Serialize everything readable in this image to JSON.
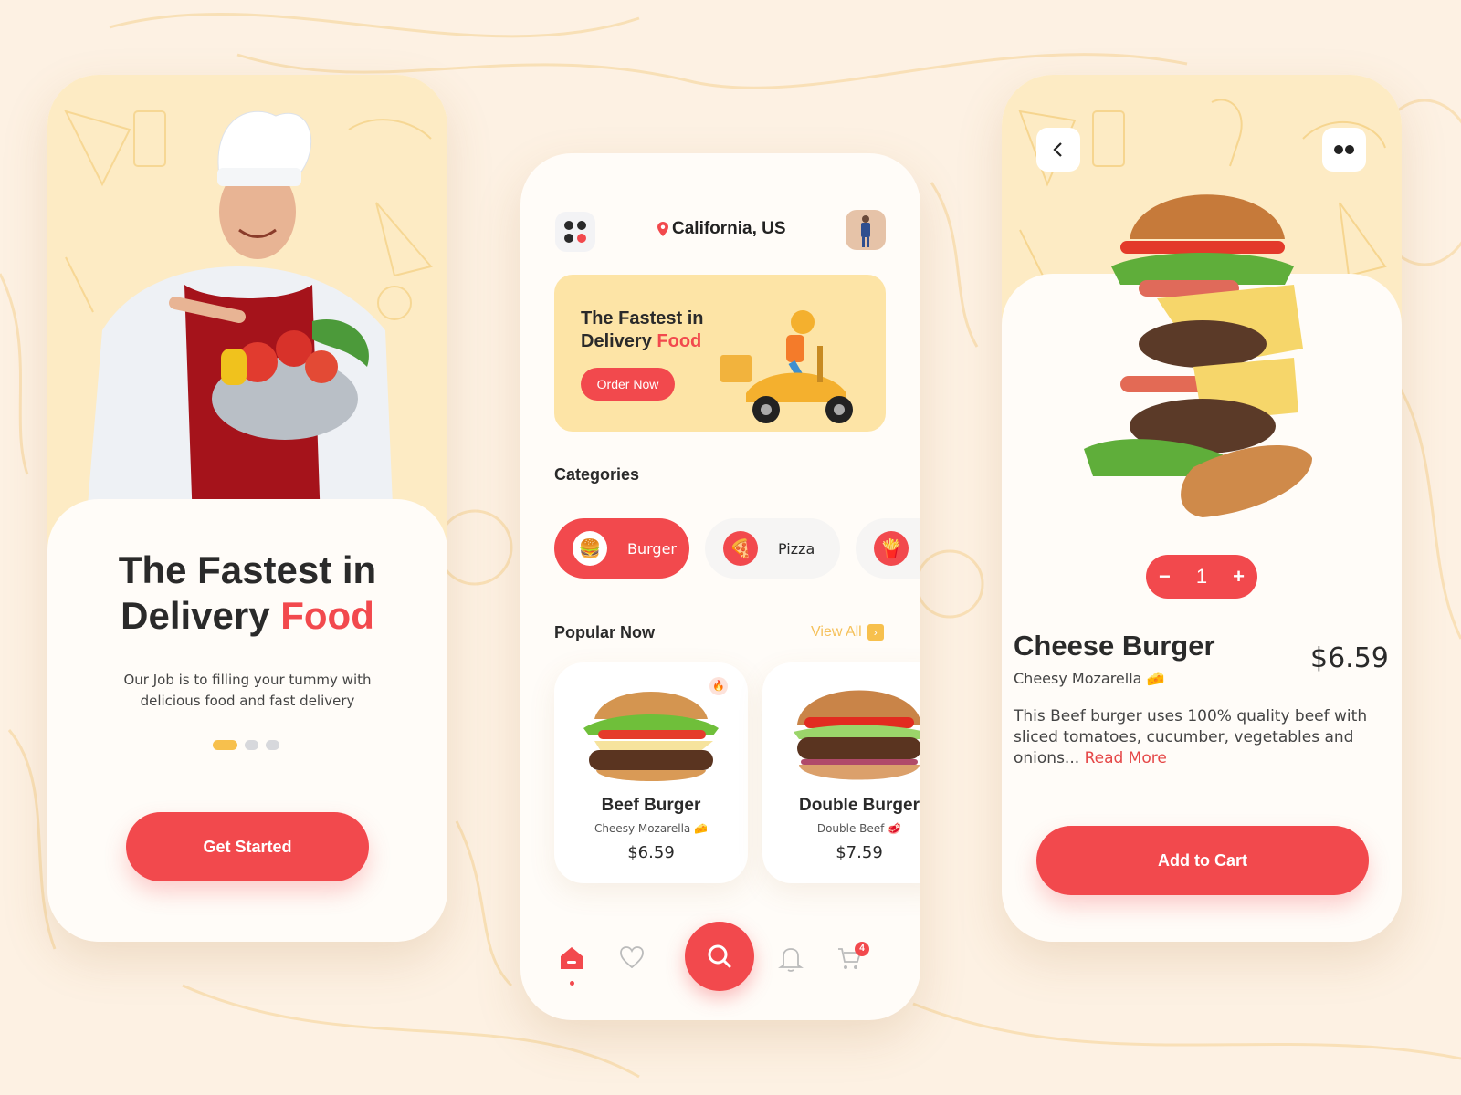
{
  "theme": {
    "accent": "#f2494d",
    "yellow": "#f7c04d",
    "cream": "#fdebc4",
    "background": "#fdf1e3"
  },
  "onboarding": {
    "title_line1": "The Fastest in",
    "title_line2_plain": "Delivery",
    "title_line2_accent": "Food",
    "subtitle": "Our Job is to filling your tummy with delicious food and fast delivery",
    "page_indicator": {
      "total": 3,
      "current": 1
    },
    "cta_label": "Get Started"
  },
  "home": {
    "menu_icon": "grid-dots-icon",
    "location": "California, US",
    "location_icon": "map-pin-icon",
    "promo": {
      "title_line1": "The Fastest in",
      "title_line2_plain": "Delivery",
      "title_line2_accent": "Food",
      "button_label": "Order Now"
    },
    "categories_title": "Categories",
    "categories": [
      {
        "label": "Burger",
        "icon": "🍔",
        "active": true
      },
      {
        "label": "Pizza",
        "icon": "🍕",
        "active": false
      },
      {
        "label": "",
        "icon": "🍟",
        "active": false
      }
    ],
    "popular_title": "Popular Now",
    "view_all_label": "View All",
    "popular": [
      {
        "name": "Beef Burger",
        "desc": "Cheesy Mozarella 🧀",
        "price": "$6.59",
        "hot": true
      },
      {
        "name": "Double Burger",
        "desc": "Double Beef 🥩",
        "price": "$7.59",
        "hot": false
      }
    ],
    "nav": {
      "items": [
        "home-icon",
        "heart-icon",
        "search-icon",
        "bell-icon",
        "cart-icon"
      ],
      "active": "home",
      "cart_badge": "4"
    }
  },
  "detail": {
    "name": "Cheese Burger",
    "subtitle": "Cheesy Mozarella 🧀",
    "price": "$6.59",
    "quantity": "1",
    "minus": "−",
    "plus": "+",
    "description": "This Beef burger uses 100% quality beef with sliced tomatoes, cucumber, vegetables and onions...",
    "read_more": "Read More",
    "cta_label": "Add to Cart"
  }
}
